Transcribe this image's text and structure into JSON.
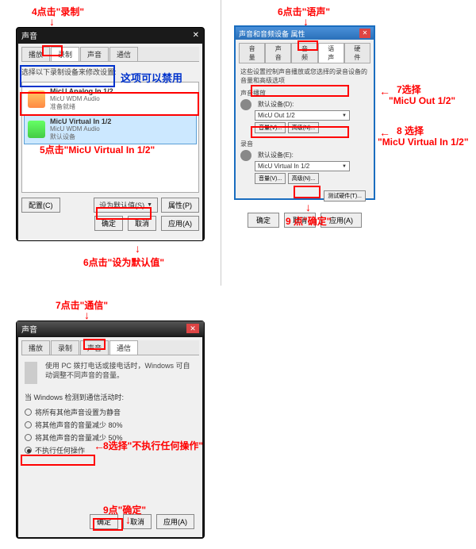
{
  "annotations": {
    "a4": "4点击\"录制\"",
    "a5": "5点击\"MicU Virtual In 1/2\"",
    "a6a": "6点击\"设为默认值\"",
    "a6b": "6点击\"语声\"",
    "a7a": "7点击\"通信\"",
    "a7b": "7选择",
    "a7c": "\"MicU Out 1/2\"",
    "a8a": "8选择\"不执行任何操作\"",
    "a8b": "8 选择",
    "a8c": "\"MicU Virtual In 1/2\"",
    "a9a": "9 点\"确定\"",
    "a9b": "9点\"确定\"",
    "disable_note": "这项可以禁用"
  },
  "dlg1": {
    "title": "声音",
    "tabs": {
      "t1": "播放",
      "t2": "录制",
      "t3": "声音",
      "t4": "通信"
    },
    "instr": "选择以下录制设备来修改设置:",
    "dev1": {
      "name": "MicU Analog In 1/2",
      "sub": "MicU WDM Audio",
      "status": "准备就绪"
    },
    "dev2": {
      "name": "MicU Virtual In 1/2",
      "sub": "MicU WDM Audio",
      "status": "默认设备"
    },
    "btn_config": "配置(C)",
    "btn_default": "设为默认值(S)",
    "btn_props": "属性(P)",
    "btn_ok": "确定",
    "btn_cancel": "取消",
    "btn_apply": "应用(A)"
  },
  "dlg2": {
    "title": "声音和音频设备 属性",
    "tabs": {
      "t1": "音量",
      "t2": "声音",
      "t3": "音频",
      "t4": "语声",
      "t5": "硬件"
    },
    "desc": "这些设置控制声音播放或您选择的录音设备的音量和高级选项",
    "grp_play": "声音播放",
    "grp_rec": "录音",
    "default_label": "默认设备(D):",
    "default_label2": "默认设备(E):",
    "sel_play": "MicU Out 1/2",
    "sel_rec": "MicU Virtual In 1/2",
    "btn_vol": "音量(V)...",
    "btn_adv": "高级(N)...",
    "btn_test": "测试硬件(T)...",
    "btn_ok": "确定",
    "btn_cancel": "取消",
    "btn_apply": "应用(A)"
  },
  "dlg3": {
    "title": "声音",
    "tabs": {
      "t1": "播放",
      "t2": "录制",
      "t3": "声音",
      "t4": "通信"
    },
    "desc": "使用 PC 拨打电话或接电话时，Windows 可自动调整不同声音的音量。",
    "question": "当 Windows 检测到通信活动时:",
    "opts": {
      "o1": "将所有其他声音设置为静音",
      "o2": "将其他声音的音量减少 80%",
      "o3": "将其他声音的音量减少 50%",
      "o4": "不执行任何操作"
    },
    "btn_ok": "确定",
    "btn_cancel": "取消",
    "btn_apply": "应用(A)"
  }
}
